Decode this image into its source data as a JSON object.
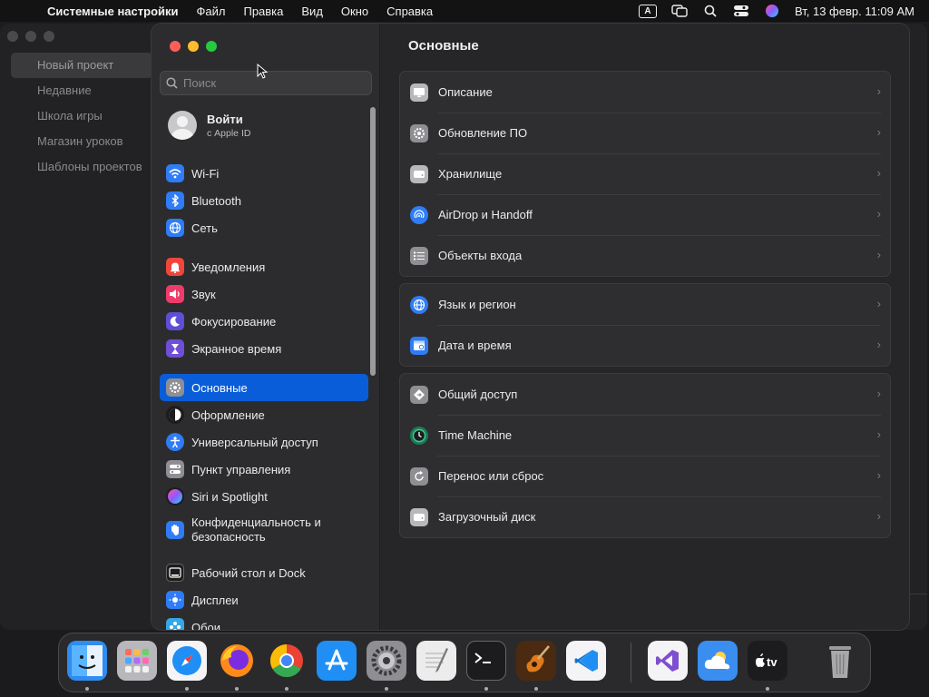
{
  "menubar": {
    "app": "Системные настройки",
    "items": [
      "Файл",
      "Правка",
      "Вид",
      "Окно",
      "Справка"
    ],
    "input_source": "A",
    "clock": "Вт, 13 февр.  11:09 AM"
  },
  "bg_window": {
    "items": [
      "Новый проект",
      "Недавние",
      "Школа игры",
      "Магазин уроков",
      "Шаблоны проектов"
    ]
  },
  "search": {
    "placeholder": "Поиск"
  },
  "profile": {
    "name": "Войти",
    "sub": "с Apple ID"
  },
  "sidebar": {
    "items": [
      {
        "label": "Wi-Fi",
        "icon": "wifi-icon",
        "color": "#2f7cf6"
      },
      {
        "label": "Bluetooth",
        "icon": "bluetooth-icon",
        "color": "#2f7cf6"
      },
      {
        "label": "Сеть",
        "icon": "network-globe-icon",
        "color": "#2f7cf6"
      },
      {
        "label": "Уведомления",
        "icon": "notifications-bell-icon",
        "color": "#f0453a"
      },
      {
        "label": "Звук",
        "icon": "sound-speaker-icon",
        "color": "#ee3c6a"
      },
      {
        "label": "Фокусирование",
        "icon": "focus-moon-icon",
        "color": "#5e4fd6"
      },
      {
        "label": "Экранное время",
        "icon": "screen-time-hourglass-icon",
        "color": "#6e4fd6"
      },
      {
        "label": "Основные",
        "icon": "general-gear-icon",
        "color": "#8e8e93"
      },
      {
        "label": "Оформление",
        "icon": "appearance-icon",
        "color": "#1c1c1e"
      },
      {
        "label": "Универсальный доступ",
        "icon": "accessibility-icon",
        "color": "#2f7cf6"
      },
      {
        "label": "Пункт управления",
        "icon": "control-center-icon",
        "color": "#8e8e93"
      },
      {
        "label": "Siri и Spotlight",
        "icon": "siri-icon",
        "color": "#c23fd0"
      },
      {
        "label": "Конфиденциальность и безопасность",
        "icon": "privacy-hand-icon",
        "color": "#2f7cf6"
      },
      {
        "label": "Рабочий стол и Dock",
        "icon": "desktop-dock-icon",
        "color": "#1c1c1e"
      },
      {
        "label": "Дисплеи",
        "icon": "displays-icon",
        "color": "#2f7cf6"
      },
      {
        "label": "Обои",
        "icon": "wallpaper-icon",
        "color": "#35a6e8"
      }
    ]
  },
  "content": {
    "title": "Основные",
    "groups": [
      [
        {
          "label": "Описание",
          "icon": "about-display-icon"
        },
        {
          "label": "Обновление ПО",
          "icon": "software-update-gear-icon"
        },
        {
          "label": "Хранилище",
          "icon": "storage-drive-icon"
        },
        {
          "label": "AirDrop и Handoff",
          "icon": "airdrop-icon"
        },
        {
          "label": "Объекты входа",
          "icon": "login-items-list-icon"
        }
      ],
      [
        {
          "label": "Язык и регион",
          "icon": "language-globe-icon"
        },
        {
          "label": "Дата и время",
          "icon": "date-time-calendar-icon"
        }
      ],
      [
        {
          "label": "Общий доступ",
          "icon": "sharing-icon"
        },
        {
          "label": "Time Machine",
          "icon": "time-machine-clock-icon"
        },
        {
          "label": "Перенос или сброс",
          "icon": "transfer-reset-icon"
        },
        {
          "label": "Загрузочный диск",
          "icon": "startup-disk-icon"
        }
      ]
    ],
    "chevron": "›"
  },
  "dock": {
    "apps": [
      {
        "name": "finder-icon",
        "glyph": "☺",
        "bg": "#2f8cf0"
      },
      {
        "name": "launchpad-icon",
        "glyph": "▦",
        "bg": "#b8b8bc"
      },
      {
        "name": "safari-icon",
        "glyph": "✦",
        "bg": "#f4f4f6"
      },
      {
        "name": "firefox-icon",
        "glyph": "●",
        "bg": "#ff7a1a"
      },
      {
        "name": "chrome-icon",
        "glyph": "◉",
        "bg": "#f4f4f6"
      },
      {
        "name": "app-store-icon",
        "glyph": "A",
        "bg": "#1f8ff5"
      },
      {
        "name": "system-settings-icon",
        "glyph": "⚙",
        "bg": "#8e8e93"
      },
      {
        "name": "textedit-icon",
        "glyph": "✎",
        "bg": "#ececec"
      },
      {
        "name": "terminal-icon",
        "glyph": ">_",
        "bg": "#1c1c1e"
      },
      {
        "name": "garageband-icon",
        "glyph": "♫",
        "bg": "#7a4a1a"
      },
      {
        "name": "vscode-icon",
        "glyph": "⟨⟩",
        "bg": "#f4f4f6"
      },
      {
        "name": "visual-studio-icon",
        "glyph": "◆",
        "bg": "#f4f4f6"
      },
      {
        "name": "weather-icon",
        "glyph": "☁",
        "bg": "#3a8ef0"
      },
      {
        "name": "apple-tv-icon",
        "glyph": "tv",
        "bg": "#1c1c1e"
      },
      {
        "name": "trash-icon",
        "glyph": "▯",
        "bg": "#2a2a2c"
      }
    ]
  }
}
